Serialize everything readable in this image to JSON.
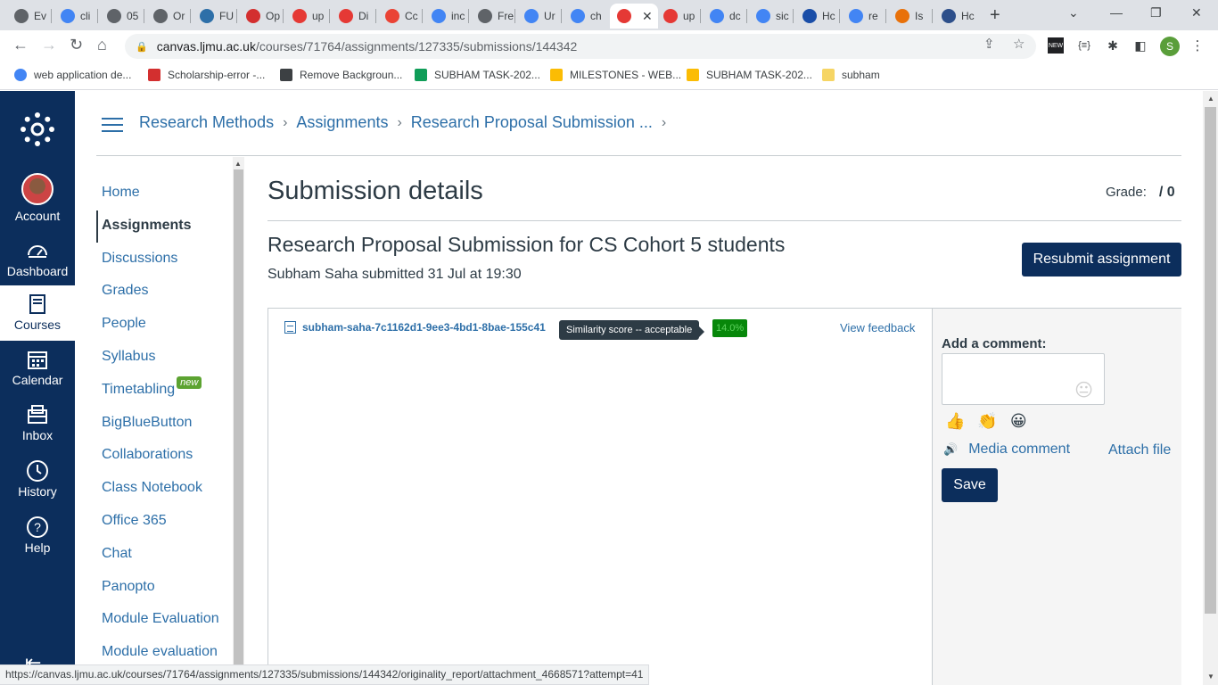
{
  "browser": {
    "tabs": [
      {
        "label": "Ev",
        "color": "#5f6368"
      },
      {
        "label": "cli",
        "color": "#4285f4"
      },
      {
        "label": "05",
        "color": "#5f6368"
      },
      {
        "label": "Or",
        "color": "#5f6368"
      },
      {
        "label": "FU",
        "color": "#2d6fa8"
      },
      {
        "label": "Op",
        "color": "#d32f2f"
      },
      {
        "label": "up",
        "color": "#e53935"
      },
      {
        "label": "Di",
        "color": "#e53935"
      },
      {
        "label": "Cc",
        "color": "#ea4335"
      },
      {
        "label": "inc",
        "color": "#4285f4"
      },
      {
        "label": "Fre",
        "color": "#5f6368"
      },
      {
        "label": "Ur",
        "color": "#4285f4"
      },
      {
        "label": "ch",
        "color": "#4285f4"
      },
      {
        "label": "",
        "color": "#e53935"
      },
      {
        "label": "up",
        "color": "#e53935"
      },
      {
        "label": "dc",
        "color": "#4285f4"
      },
      {
        "label": "sic",
        "color": "#4285f4"
      },
      {
        "label": "Hc",
        "color": "#1a4ea8"
      },
      {
        "label": "re",
        "color": "#4285f4"
      },
      {
        "label": "Is",
        "color": "#e8710a"
      },
      {
        "label": "Hc",
        "color": "#2d4f8a"
      }
    ],
    "new_tab": "+",
    "url_host": "canvas.ljmu.ac.uk",
    "url_path": "/courses/71764/assignments/127335/submissions/144342",
    "bookmarks": [
      {
        "label": "web application de...",
        "icon": "google-icon",
        "color": "#4285f4"
      },
      {
        "label": "Scholarship-error -...",
        "icon": "canvas-icon",
        "color": "#d32f2f"
      },
      {
        "label": "Remove Backgroun...",
        "icon": "layers-icon",
        "color": "#3c4043"
      },
      {
        "label": "SUBHAM TASK-202...",
        "icon": "sheets-icon",
        "color": "#0f9d58"
      },
      {
        "label": "MILESTONES - WEB...",
        "icon": "drive-icon",
        "color": "#fbbc04"
      },
      {
        "label": "SUBHAM TASK-202...",
        "icon": "drive-icon",
        "color": "#fbbc04"
      },
      {
        "label": "subham",
        "icon": "folder-icon",
        "color": "#f6d564"
      }
    ],
    "profile_initial": "S",
    "status_url": "https://canvas.ljmu.ac.uk/courses/71764/assignments/127335/submissions/144342/originality_report/attachment_4668571?attempt=41"
  },
  "global_nav": {
    "account": "Account",
    "dashboard": "Dashboard",
    "courses": "Courses",
    "calendar": "Calendar",
    "inbox": "Inbox",
    "history": "History",
    "help": "Help"
  },
  "breadcrumb": [
    "Research Methods",
    "Assignments",
    "Research Proposal Submission ..."
  ],
  "course_nav": [
    {
      "label": "Home"
    },
    {
      "label": "Assignments",
      "active": true
    },
    {
      "label": "Discussions"
    },
    {
      "label": "Grades"
    },
    {
      "label": "People"
    },
    {
      "label": "Syllabus"
    },
    {
      "label": "Timetabling",
      "badge": "new"
    },
    {
      "label": "BigBlueButton"
    },
    {
      "label": "Collaborations"
    },
    {
      "label": "Class Notebook"
    },
    {
      "label": "Office 365"
    },
    {
      "label": "Chat"
    },
    {
      "label": "Panopto"
    },
    {
      "label": "Module Evaluation"
    },
    {
      "label": "Module evaluation"
    }
  ],
  "page": {
    "title": "Submission details",
    "grade_label": "Grade:",
    "grade_value": "/ 0",
    "assignment_title": "Research Proposal Submission for CS Cohort 5 students",
    "submitted_by": "Subham Saha submitted 31 Jul at 19:30",
    "resubmit_label": "Resubmit assignment"
  },
  "submission": {
    "filename": "subham-saha-7c1162d1-9ee3-4bd1-8bae-155c41",
    "tooltip": "Similarity score -- acceptable",
    "score": "14.0%",
    "view_feedback": "View feedback"
  },
  "comment": {
    "label": "Add a comment:",
    "reactions": [
      "👍",
      "👏",
      "😀"
    ],
    "media_comment": "Media comment",
    "attach_file": "Attach file",
    "save": "Save"
  },
  "colors": {
    "canvas_nav": "#0c2e5c",
    "link": "#2d6fa8",
    "score_bg": "#07870a"
  }
}
